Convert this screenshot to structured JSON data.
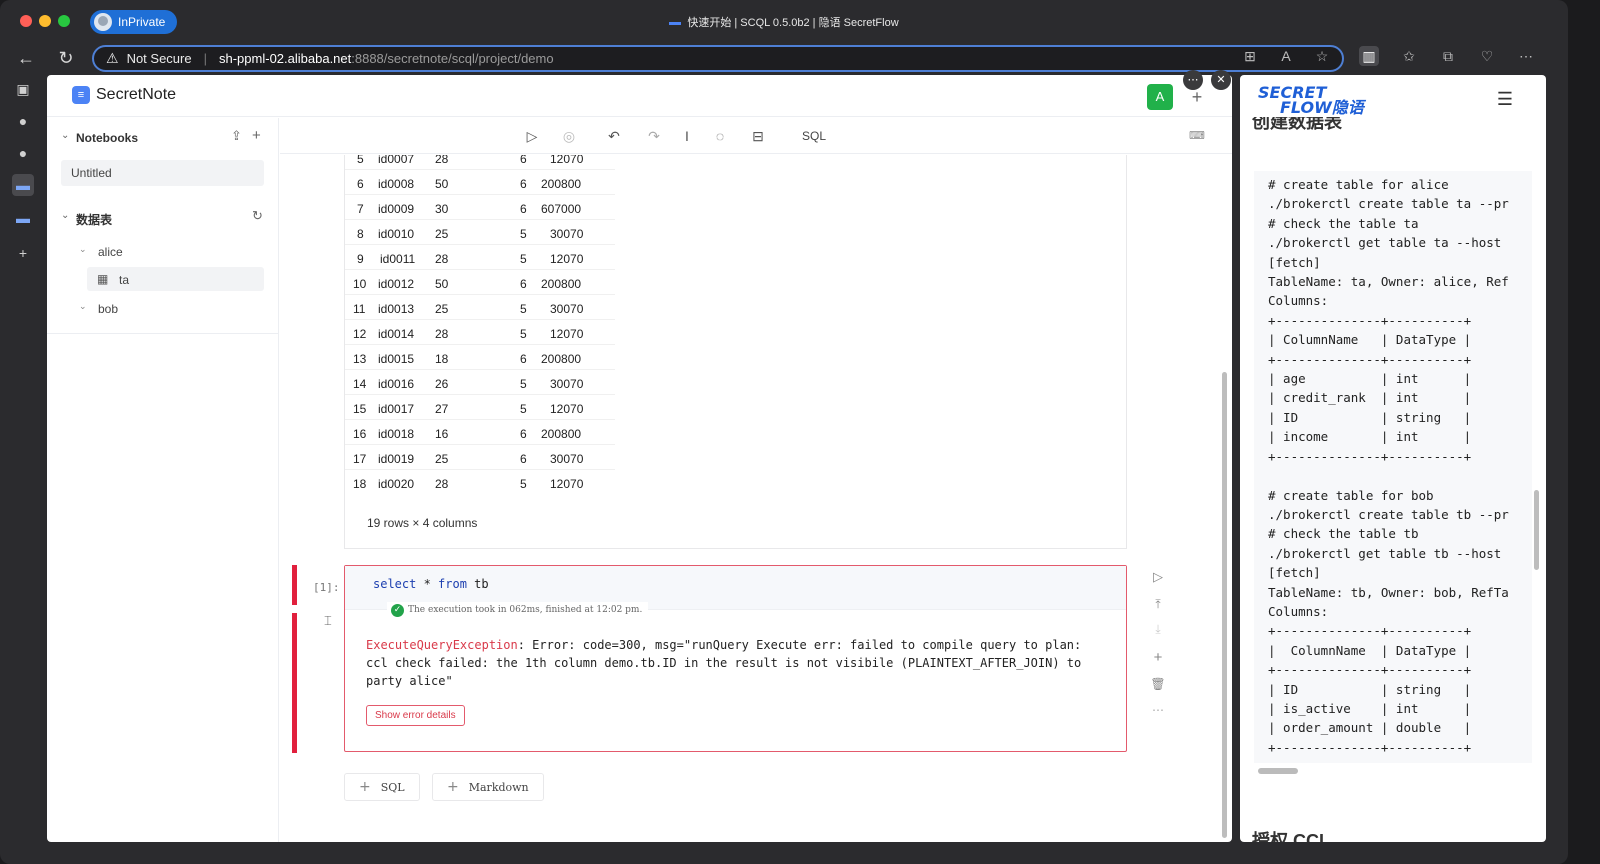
{
  "browser": {
    "window_title": "快速开始 | SCQL 0.5.0b2 | 隐语 SecretFlow",
    "inprivate_label": "InPrivate",
    "security_label": "Not Secure",
    "url_host": "sh-ppml-02.alibaba.net",
    "url_path": ":8888/secretnote/scql/project/demo"
  },
  "app": {
    "title": "SecretNote",
    "user_initial": "A"
  },
  "sidebar": {
    "notebooks_label": "Notebooks",
    "notebook_items": [
      "Untitled"
    ],
    "datatables_label": "数据表",
    "tree": {
      "party_alice": "alice",
      "table_ta": "ta",
      "party_bob": "bob"
    }
  },
  "toolbar": {
    "mode_label": "SQL"
  },
  "output_table": {
    "rows": [
      [
        "5",
        "id0007",
        "28",
        "6",
        "12070"
      ],
      [
        "6",
        "id0008",
        "50",
        "6",
        "200800"
      ],
      [
        "7",
        "id0009",
        "30",
        "6",
        "607000"
      ],
      [
        "8",
        "id0010",
        "25",
        "5",
        "30070"
      ],
      [
        "9",
        "id0011",
        "28",
        "5",
        "12070"
      ],
      [
        "10",
        "id0012",
        "50",
        "6",
        "200800"
      ],
      [
        "11",
        "id0013",
        "25",
        "5",
        "30070"
      ],
      [
        "12",
        "id0014",
        "28",
        "5",
        "12070"
      ],
      [
        "13",
        "id0015",
        "18",
        "6",
        "200800"
      ],
      [
        "14",
        "id0016",
        "26",
        "5",
        "30070"
      ],
      [
        "15",
        "id0017",
        "27",
        "5",
        "12070"
      ],
      [
        "16",
        "id0018",
        "16",
        "6",
        "200800"
      ],
      [
        "17",
        "id0019",
        "25",
        "6",
        "30070"
      ],
      [
        "18",
        "id0020",
        "28",
        "5",
        "12070"
      ]
    ],
    "summary": "19 rows × 4 columns"
  },
  "cell": {
    "number": "[1]:",
    "code_kw1": "select",
    "code_mid": " * ",
    "code_kw2": "from",
    "code_end": " tb",
    "exec_info": "The execution took in 062ms, finished at 12:02 pm.",
    "error_type": "ExecuteQueryException",
    "error_text": ": Error: code=300, msg=\"runQuery Execute err: failed to compile query to plan: ccl check failed: the 1th column demo.tb.ID in the result is not visibile (PLAINTEXT_AFTER_JOIN) to party alice\"",
    "show_error_label": "Show error details"
  },
  "add_buttons": {
    "sql_label": "SQL",
    "markdown_label": "Markdown"
  },
  "docs_panel": {
    "logo_line1": "SECRET",
    "logo_line2": "FLOW隐语",
    "top_heading_cut": "创建数据表",
    "code_lines": [
      "# create table for alice",
      "./brokerctl create table ta --pr",
      "# check the table ta",
      "./brokerctl get table ta --host",
      "[fetch]",
      "TableName: ta, Owner: alice, Ref",
      "Columns:",
      "+--------------+----------+",
      "| ColumnName   | DataType |",
      "+--------------+----------+",
      "| age          | int      |",
      "| credit_rank  | int      |",
      "| ID           | string   |",
      "| income       | int      |",
      "+--------------+----------+",
      "",
      "# create table for bob",
      "./brokerctl create table tb --pr",
      "# check the table tb",
      "./brokerctl get table tb --host",
      "[fetch]",
      "TableName: tb, Owner: bob, RefTa",
      "Columns:",
      "+--------------+----------+",
      "|  ColumnName  | DataType |",
      "+--------------+----------+",
      "| ID           | string   |",
      "| is_active    | int      |",
      "| order_amount | double   |",
      "+--------------+----------+"
    ],
    "bottom_heading_cut": "授权 CCL"
  }
}
